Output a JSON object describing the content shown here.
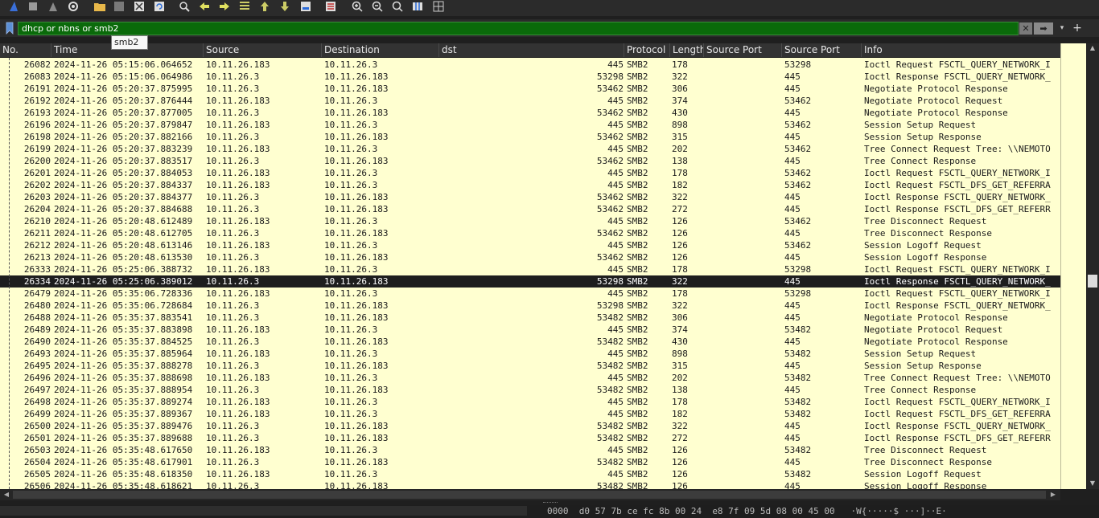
{
  "toolbar": {
    "buttons": [
      "shark-fin-icon",
      "stop-icon",
      "restart-icon",
      "options-gear-icon",
      "open-folder-icon",
      "save-icon",
      "close-file-icon",
      "reload-icon",
      "find-icon",
      "go-back-icon",
      "go-forward-icon",
      "go-to-packet-icon",
      "first-packet-icon",
      "last-packet-icon",
      "auto-scroll-icon",
      "colorize-icon",
      "zoom-in-icon",
      "zoom-out-icon",
      "normal-size-icon",
      "resize-columns-icon",
      "layout-icon"
    ]
  },
  "filter": {
    "value": "dhcp or nbns or smb2",
    "autocomplete": "smb2"
  },
  "columns": {
    "no": "No.",
    "time": "Time",
    "source": "Source",
    "destination": "Destination",
    "dst": "dst",
    "protocol": "Protocol",
    "length": "Length",
    "source_port": "Source Port",
    "source_port2": "Source Port",
    "info": "Info"
  },
  "packets": [
    {
      "no": "26082",
      "time": "2024-11-26 05:15:06.064652",
      "src": "10.11.26.183",
      "dst": "10.11.26.3",
      "dst2": "445",
      "proto": "SMB2",
      "len": "178",
      "sport": "",
      "sport2": "53298",
      "info": "Ioctl Request FSCTL_QUERY_NETWORK_I"
    },
    {
      "no": "26083",
      "time": "2024-11-26 05:15:06.064986",
      "src": "10.11.26.3",
      "dst": "10.11.26.183",
      "dst2": "53298",
      "proto": "SMB2",
      "len": "322",
      "sport": "",
      "sport2": "445",
      "info": "Ioctl Response FSCTL_QUERY_NETWORK_"
    },
    {
      "no": "26191",
      "time": "2024-11-26 05:20:37.875995",
      "src": "10.11.26.3",
      "dst": "10.11.26.183",
      "dst2": "53462",
      "proto": "SMB2",
      "len": "306",
      "sport": "",
      "sport2": "445",
      "info": "Negotiate Protocol Response"
    },
    {
      "no": "26192",
      "time": "2024-11-26 05:20:37.876444",
      "src": "10.11.26.183",
      "dst": "10.11.26.3",
      "dst2": "445",
      "proto": "SMB2",
      "len": "374",
      "sport": "",
      "sport2": "53462",
      "info": "Negotiate Protocol Request"
    },
    {
      "no": "26193",
      "time": "2024-11-26 05:20:37.877005",
      "src": "10.11.26.3",
      "dst": "10.11.26.183",
      "dst2": "53462",
      "proto": "SMB2",
      "len": "430",
      "sport": "",
      "sport2": "445",
      "info": "Negotiate Protocol Response"
    },
    {
      "no": "26196",
      "time": "2024-11-26 05:20:37.879847",
      "src": "10.11.26.183",
      "dst": "10.11.26.3",
      "dst2": "445",
      "proto": "SMB2",
      "len": "898",
      "sport": "",
      "sport2": "53462",
      "info": "Session Setup Request"
    },
    {
      "no": "26198",
      "time": "2024-11-26 05:20:37.882166",
      "src": "10.11.26.3",
      "dst": "10.11.26.183",
      "dst2": "53462",
      "proto": "SMB2",
      "len": "315",
      "sport": "",
      "sport2": "445",
      "info": "Session Setup Response"
    },
    {
      "no": "26199",
      "time": "2024-11-26 05:20:37.883239",
      "src": "10.11.26.183",
      "dst": "10.11.26.3",
      "dst2": "445",
      "proto": "SMB2",
      "len": "202",
      "sport": "",
      "sport2": "53462",
      "info": "Tree Connect Request Tree: \\\\NEMOTO"
    },
    {
      "no": "26200",
      "time": "2024-11-26 05:20:37.883517",
      "src": "10.11.26.3",
      "dst": "10.11.26.183",
      "dst2": "53462",
      "proto": "SMB2",
      "len": "138",
      "sport": "",
      "sport2": "445",
      "info": "Tree Connect Response"
    },
    {
      "no": "26201",
      "time": "2024-11-26 05:20:37.884053",
      "src": "10.11.26.183",
      "dst": "10.11.26.3",
      "dst2": "445",
      "proto": "SMB2",
      "len": "178",
      "sport": "",
      "sport2": "53462",
      "info": "Ioctl Request FSCTL_QUERY_NETWORK_I"
    },
    {
      "no": "26202",
      "time": "2024-11-26 05:20:37.884337",
      "src": "10.11.26.183",
      "dst": "10.11.26.3",
      "dst2": "445",
      "proto": "SMB2",
      "len": "182",
      "sport": "",
      "sport2": "53462",
      "info": "Ioctl Request FSCTL_DFS_GET_REFERRA"
    },
    {
      "no": "26203",
      "time": "2024-11-26 05:20:37.884377",
      "src": "10.11.26.3",
      "dst": "10.11.26.183",
      "dst2": "53462",
      "proto": "SMB2",
      "len": "322",
      "sport": "",
      "sport2": "445",
      "info": "Ioctl Response FSCTL_QUERY_NETWORK_"
    },
    {
      "no": "26204",
      "time": "2024-11-26 05:20:37.884688",
      "src": "10.11.26.3",
      "dst": "10.11.26.183",
      "dst2": "53462",
      "proto": "SMB2",
      "len": "272",
      "sport": "",
      "sport2": "445",
      "info": "Ioctl Response FSCTL_DFS_GET_REFERR"
    },
    {
      "no": "26210",
      "time": "2024-11-26 05:20:48.612489",
      "src": "10.11.26.183",
      "dst": "10.11.26.3",
      "dst2": "445",
      "proto": "SMB2",
      "len": "126",
      "sport": "",
      "sport2": "53462",
      "info": "Tree Disconnect Request"
    },
    {
      "no": "26211",
      "time": "2024-11-26 05:20:48.612705",
      "src": "10.11.26.3",
      "dst": "10.11.26.183",
      "dst2": "53462",
      "proto": "SMB2",
      "len": "126",
      "sport": "",
      "sport2": "445",
      "info": "Tree Disconnect Response"
    },
    {
      "no": "26212",
      "time": "2024-11-26 05:20:48.613146",
      "src": "10.11.26.183",
      "dst": "10.11.26.3",
      "dst2": "445",
      "proto": "SMB2",
      "len": "126",
      "sport": "",
      "sport2": "53462",
      "info": "Session Logoff Request"
    },
    {
      "no": "26213",
      "time": "2024-11-26 05:20:48.613530",
      "src": "10.11.26.3",
      "dst": "10.11.26.183",
      "dst2": "53462",
      "proto": "SMB2",
      "len": "126",
      "sport": "",
      "sport2": "445",
      "info": "Session Logoff Response"
    },
    {
      "no": "26333",
      "time": "2024-11-26 05:25:06.388732",
      "src": "10.11.26.183",
      "dst": "10.11.26.3",
      "dst2": "445",
      "proto": "SMB2",
      "len": "178",
      "sport": "",
      "sport2": "53298",
      "info": "Ioctl Request FSCTL_QUERY_NETWORK_I"
    },
    {
      "no": "26334",
      "time": "2024-11-26 05:25:06.389012",
      "src": "10.11.26.3",
      "dst": "10.11.26.183",
      "dst2": "53298",
      "proto": "SMB2",
      "len": "322",
      "sport": "",
      "sport2": "445",
      "info": "Ioctl Response FSCTL_QUERY_NETWORK_",
      "selected": true
    },
    {
      "no": "26479",
      "time": "2024-11-26 05:35:06.728336",
      "src": "10.11.26.183",
      "dst": "10.11.26.3",
      "dst2": "445",
      "proto": "SMB2",
      "len": "178",
      "sport": "",
      "sport2": "53298",
      "info": "Ioctl Request FSCTL_QUERY_NETWORK_I"
    },
    {
      "no": "26480",
      "time": "2024-11-26 05:35:06.728684",
      "src": "10.11.26.3",
      "dst": "10.11.26.183",
      "dst2": "53298",
      "proto": "SMB2",
      "len": "322",
      "sport": "",
      "sport2": "445",
      "info": "Ioctl Response FSCTL_QUERY_NETWORK_"
    },
    {
      "no": "26488",
      "time": "2024-11-26 05:35:37.883541",
      "src": "10.11.26.3",
      "dst": "10.11.26.183",
      "dst2": "53482",
      "proto": "SMB2",
      "len": "306",
      "sport": "",
      "sport2": "445",
      "info": "Negotiate Protocol Response"
    },
    {
      "no": "26489",
      "time": "2024-11-26 05:35:37.883898",
      "src": "10.11.26.183",
      "dst": "10.11.26.3",
      "dst2": "445",
      "proto": "SMB2",
      "len": "374",
      "sport": "",
      "sport2": "53482",
      "info": "Negotiate Protocol Request"
    },
    {
      "no": "26490",
      "time": "2024-11-26 05:35:37.884525",
      "src": "10.11.26.3",
      "dst": "10.11.26.183",
      "dst2": "53482",
      "proto": "SMB2",
      "len": "430",
      "sport": "",
      "sport2": "445",
      "info": "Negotiate Protocol Response"
    },
    {
      "no": "26493",
      "time": "2024-11-26 05:35:37.885964",
      "src": "10.11.26.183",
      "dst": "10.11.26.3",
      "dst2": "445",
      "proto": "SMB2",
      "len": "898",
      "sport": "",
      "sport2": "53482",
      "info": "Session Setup Request"
    },
    {
      "no": "26495",
      "time": "2024-11-26 05:35:37.888278",
      "src": "10.11.26.3",
      "dst": "10.11.26.183",
      "dst2": "53482",
      "proto": "SMB2",
      "len": "315",
      "sport": "",
      "sport2": "445",
      "info": "Session Setup Response"
    },
    {
      "no": "26496",
      "time": "2024-11-26 05:35:37.888698",
      "src": "10.11.26.183",
      "dst": "10.11.26.3",
      "dst2": "445",
      "proto": "SMB2",
      "len": "202",
      "sport": "",
      "sport2": "53482",
      "info": "Tree Connect Request Tree: \\\\NEMOTO"
    },
    {
      "no": "26497",
      "time": "2024-11-26 05:35:37.888954",
      "src": "10.11.26.3",
      "dst": "10.11.26.183",
      "dst2": "53482",
      "proto": "SMB2",
      "len": "138",
      "sport": "",
      "sport2": "445",
      "info": "Tree Connect Response"
    },
    {
      "no": "26498",
      "time": "2024-11-26 05:35:37.889274",
      "src": "10.11.26.183",
      "dst": "10.11.26.3",
      "dst2": "445",
      "proto": "SMB2",
      "len": "178",
      "sport": "",
      "sport2": "53482",
      "info": "Ioctl Request FSCTL_QUERY_NETWORK_I"
    },
    {
      "no": "26499",
      "time": "2024-11-26 05:35:37.889367",
      "src": "10.11.26.183",
      "dst": "10.11.26.3",
      "dst2": "445",
      "proto": "SMB2",
      "len": "182",
      "sport": "",
      "sport2": "53482",
      "info": "Ioctl Request FSCTL_DFS_GET_REFERRA"
    },
    {
      "no": "26500",
      "time": "2024-11-26 05:35:37.889476",
      "src": "10.11.26.3",
      "dst": "10.11.26.183",
      "dst2": "53482",
      "proto": "SMB2",
      "len": "322",
      "sport": "",
      "sport2": "445",
      "info": "Ioctl Response FSCTL_QUERY_NETWORK_"
    },
    {
      "no": "26501",
      "time": "2024-11-26 05:35:37.889688",
      "src": "10.11.26.3",
      "dst": "10.11.26.183",
      "dst2": "53482",
      "proto": "SMB2",
      "len": "272",
      "sport": "",
      "sport2": "445",
      "info": "Ioctl Response FSCTL_DFS_GET_REFERR"
    },
    {
      "no": "26503",
      "time": "2024-11-26 05:35:48.617650",
      "src": "10.11.26.183",
      "dst": "10.11.26.3",
      "dst2": "445",
      "proto": "SMB2",
      "len": "126",
      "sport": "",
      "sport2": "53482",
      "info": "Tree Disconnect Request"
    },
    {
      "no": "26504",
      "time": "2024-11-26 05:35:48.617901",
      "src": "10.11.26.3",
      "dst": "10.11.26.183",
      "dst2": "53482",
      "proto": "SMB2",
      "len": "126",
      "sport": "",
      "sport2": "445",
      "info": "Tree Disconnect Response"
    },
    {
      "no": "26505",
      "time": "2024-11-26 05:35:48.618350",
      "src": "10.11.26.183",
      "dst": "10.11.26.3",
      "dst2": "445",
      "proto": "SMB2",
      "len": "126",
      "sport": "",
      "sport2": "53482",
      "info": "Session Logoff Request"
    },
    {
      "no": "26506",
      "time": "2024-11-26 05:35:48.618621",
      "src": "10.11.26.3",
      "dst": "10.11.26.183",
      "dst2": "53482",
      "proto": "SMB2",
      "len": "126",
      "sport": "",
      "sport2": "445",
      "info": "Session Logoff Response"
    }
  ],
  "bytes": {
    "offset": "0000",
    "hex": "d0 57 7b ce fc 8b 00 24  e8 7f 09 5d 08 00 45 00",
    "ascii": "·W{·····$ ···]··E·"
  },
  "colors": {
    "row_bg": "#ffffd0",
    "selected_bg": "#1e1e1e",
    "filter_bg": "#0a6a0a"
  }
}
